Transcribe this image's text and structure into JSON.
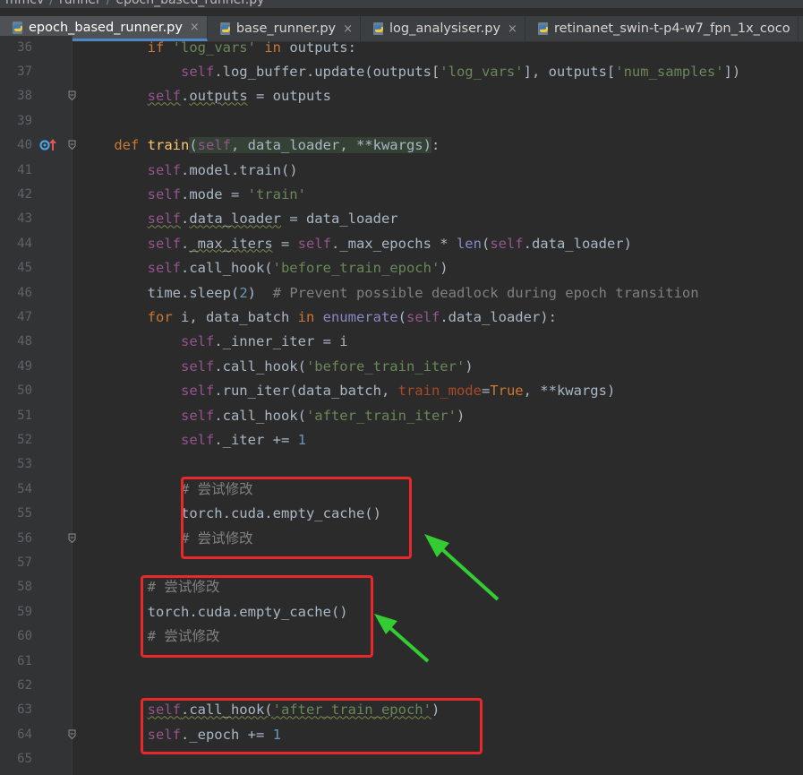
{
  "breadcrumb": {
    "items": [
      "mmcv",
      "runner",
      "epoch_based_runner.py"
    ]
  },
  "tabs": [
    {
      "label": "epoch_based_runner.py",
      "active": true,
      "close": "×"
    },
    {
      "label": "base_runner.py",
      "active": false,
      "close": "×"
    },
    {
      "label": "log_analysiser.py",
      "active": false,
      "close": "×"
    },
    {
      "label": "retinanet_swin-t-p4-w7_fpn_1x_coco",
      "active": false,
      "close": ""
    }
  ],
  "colors": {
    "background": "#2b2b2b",
    "keyword": "#cc7832",
    "self": "#94558d",
    "string": "#6a8759",
    "number": "#6897bb",
    "comment": "#808080",
    "function": "#ffc66d",
    "annotation_box": "#e8282a",
    "annotation_arrow": "#33cc33"
  },
  "code_lines": [
    {
      "n": "36",
      "tokens": [
        [
          "        ",
          ""
        ],
        [
          "if ",
          "kw"
        ],
        [
          "'log_vars'",
          "str"
        ],
        [
          " in ",
          "kw"
        ],
        [
          "outputs:",
          ""
        ]
      ]
    },
    {
      "n": "37",
      "tokens": [
        [
          "            ",
          ""
        ],
        [
          "self",
          "self"
        ],
        [
          ".log_buffer.update(outputs[",
          ""
        ],
        [
          "'log_vars'",
          "str"
        ],
        [
          "], outputs[",
          ""
        ],
        [
          "'num_samples'",
          "str"
        ],
        [
          "])",
          ""
        ]
      ]
    },
    {
      "n": "38",
      "tokens": [
        [
          "        ",
          ""
        ],
        [
          "self",
          "self wavy"
        ],
        [
          ".",
          ""
        ],
        [
          "outputs",
          "wavy"
        ],
        [
          " = outputs",
          ""
        ]
      ]
    },
    {
      "n": "39",
      "tokens": []
    },
    {
      "n": "40",
      "tokens": [
        [
          "    ",
          ""
        ],
        [
          "def ",
          "kw"
        ],
        [
          "train",
          "fn"
        ],
        [
          "(",
          "paramhl"
        ],
        [
          "self",
          "self paramhl"
        ],
        [
          ", data_loader, **kwargs",
          "paramhl"
        ],
        [
          ")",
          "paramhl"
        ],
        [
          ":",
          ""
        ]
      ]
    },
    {
      "n": "41",
      "tokens": [
        [
          "        ",
          ""
        ],
        [
          "self",
          "self"
        ],
        [
          ".model.train()",
          ""
        ]
      ]
    },
    {
      "n": "42",
      "tokens": [
        [
          "        ",
          ""
        ],
        [
          "self",
          "self"
        ],
        [
          ".mode = ",
          ""
        ],
        [
          "'train'",
          "str"
        ]
      ]
    },
    {
      "n": "43",
      "tokens": [
        [
          "        ",
          ""
        ],
        [
          "self",
          "self wavy"
        ],
        [
          ".",
          ""
        ],
        [
          "data_loader",
          "wavy"
        ],
        [
          " = data_loader",
          ""
        ]
      ]
    },
    {
      "n": "44",
      "tokens": [
        [
          "        ",
          ""
        ],
        [
          "self",
          "self"
        ],
        [
          ".",
          ""
        ],
        [
          "_max_iters",
          "wavy"
        ],
        [
          " = ",
          ""
        ],
        [
          "self",
          "self"
        ],
        [
          "._max_epochs * ",
          ""
        ],
        [
          "len",
          "bi"
        ],
        [
          "(",
          ""
        ],
        [
          "self",
          "self"
        ],
        [
          ".data_loader)",
          ""
        ]
      ]
    },
    {
      "n": "45",
      "tokens": [
        [
          "        ",
          ""
        ],
        [
          "self",
          "self"
        ],
        [
          ".call_hook(",
          ""
        ],
        [
          "'before_train_epoch'",
          "str"
        ],
        [
          ")",
          ""
        ]
      ]
    },
    {
      "n": "46",
      "tokens": [
        [
          "        ",
          ""
        ],
        [
          "time.sleep(",
          ""
        ],
        [
          "2",
          "num"
        ],
        [
          ")  ",
          ""
        ],
        [
          "# Prevent possible deadlock during epoch transition",
          "cm"
        ]
      ]
    },
    {
      "n": "47",
      "tokens": [
        [
          "        ",
          ""
        ],
        [
          "for ",
          "kw"
        ],
        [
          "i, data_batch ",
          ""
        ],
        [
          "in ",
          "kw"
        ],
        [
          "enumerate",
          "bi"
        ],
        [
          "(",
          ""
        ],
        [
          "self",
          "self"
        ],
        [
          ".data_loader):",
          ""
        ]
      ]
    },
    {
      "n": "48",
      "tokens": [
        [
          "            ",
          ""
        ],
        [
          "self",
          "self"
        ],
        [
          "._inner_iter = i",
          ""
        ]
      ]
    },
    {
      "n": "49",
      "tokens": [
        [
          "            ",
          ""
        ],
        [
          "self",
          "self"
        ],
        [
          ".call_hook(",
          ""
        ],
        [
          "'before_train_iter'",
          "str"
        ],
        [
          ")",
          ""
        ]
      ]
    },
    {
      "n": "50",
      "tokens": [
        [
          "            ",
          ""
        ],
        [
          "self",
          "self"
        ],
        [
          ".run_iter(data_batch, ",
          ""
        ],
        [
          "train_mode",
          "kwarg"
        ],
        [
          "=",
          ""
        ],
        [
          "True",
          "kw"
        ],
        [
          ", **kwargs)",
          ""
        ]
      ]
    },
    {
      "n": "51",
      "tokens": [
        [
          "            ",
          ""
        ],
        [
          "self",
          "self"
        ],
        [
          ".call_hook(",
          ""
        ],
        [
          "'after_train_iter'",
          "str"
        ],
        [
          ")",
          ""
        ]
      ]
    },
    {
      "n": "52",
      "tokens": [
        [
          "            ",
          ""
        ],
        [
          "self",
          "self"
        ],
        [
          "._iter += ",
          ""
        ],
        [
          "1",
          "num"
        ]
      ]
    },
    {
      "n": "53",
      "tokens": []
    },
    {
      "n": "54",
      "tokens": [
        [
          "            ",
          ""
        ],
        [
          "# 尝试修改",
          "cm"
        ]
      ]
    },
    {
      "n": "55",
      "tokens": [
        [
          "            ",
          ""
        ],
        [
          "torch.cuda.empty_cache()",
          ""
        ]
      ]
    },
    {
      "n": "56",
      "tokens": [
        [
          "            ",
          ""
        ],
        [
          "# 尝试修改",
          "cm"
        ]
      ]
    },
    {
      "n": "57",
      "tokens": []
    },
    {
      "n": "58",
      "tokens": [
        [
          "        ",
          ""
        ],
        [
          "# 尝试修改",
          "cm"
        ]
      ]
    },
    {
      "n": "59",
      "tokens": [
        [
          "        ",
          ""
        ],
        [
          "torch.cuda.empty_cache()",
          ""
        ]
      ]
    },
    {
      "n": "60",
      "tokens": [
        [
          "        ",
          ""
        ],
        [
          "# 尝试修改",
          "cm"
        ]
      ]
    },
    {
      "n": "61",
      "tokens": []
    },
    {
      "n": "62",
      "tokens": []
    },
    {
      "n": "63",
      "tokens": [
        [
          "        ",
          ""
        ],
        [
          "self",
          "self wavy"
        ],
        [
          ".call_hook(",
          "wavy"
        ],
        [
          "'after_train_epoch'",
          "str wavy"
        ],
        [
          ")",
          ""
        ]
      ]
    },
    {
      "n": "64",
      "tokens": [
        [
          "        ",
          ""
        ],
        [
          "self",
          "self"
        ],
        [
          "._epoch += ",
          ""
        ],
        [
          "1",
          "num"
        ]
      ]
    },
    {
      "n": "65",
      "tokens": []
    }
  ]
}
